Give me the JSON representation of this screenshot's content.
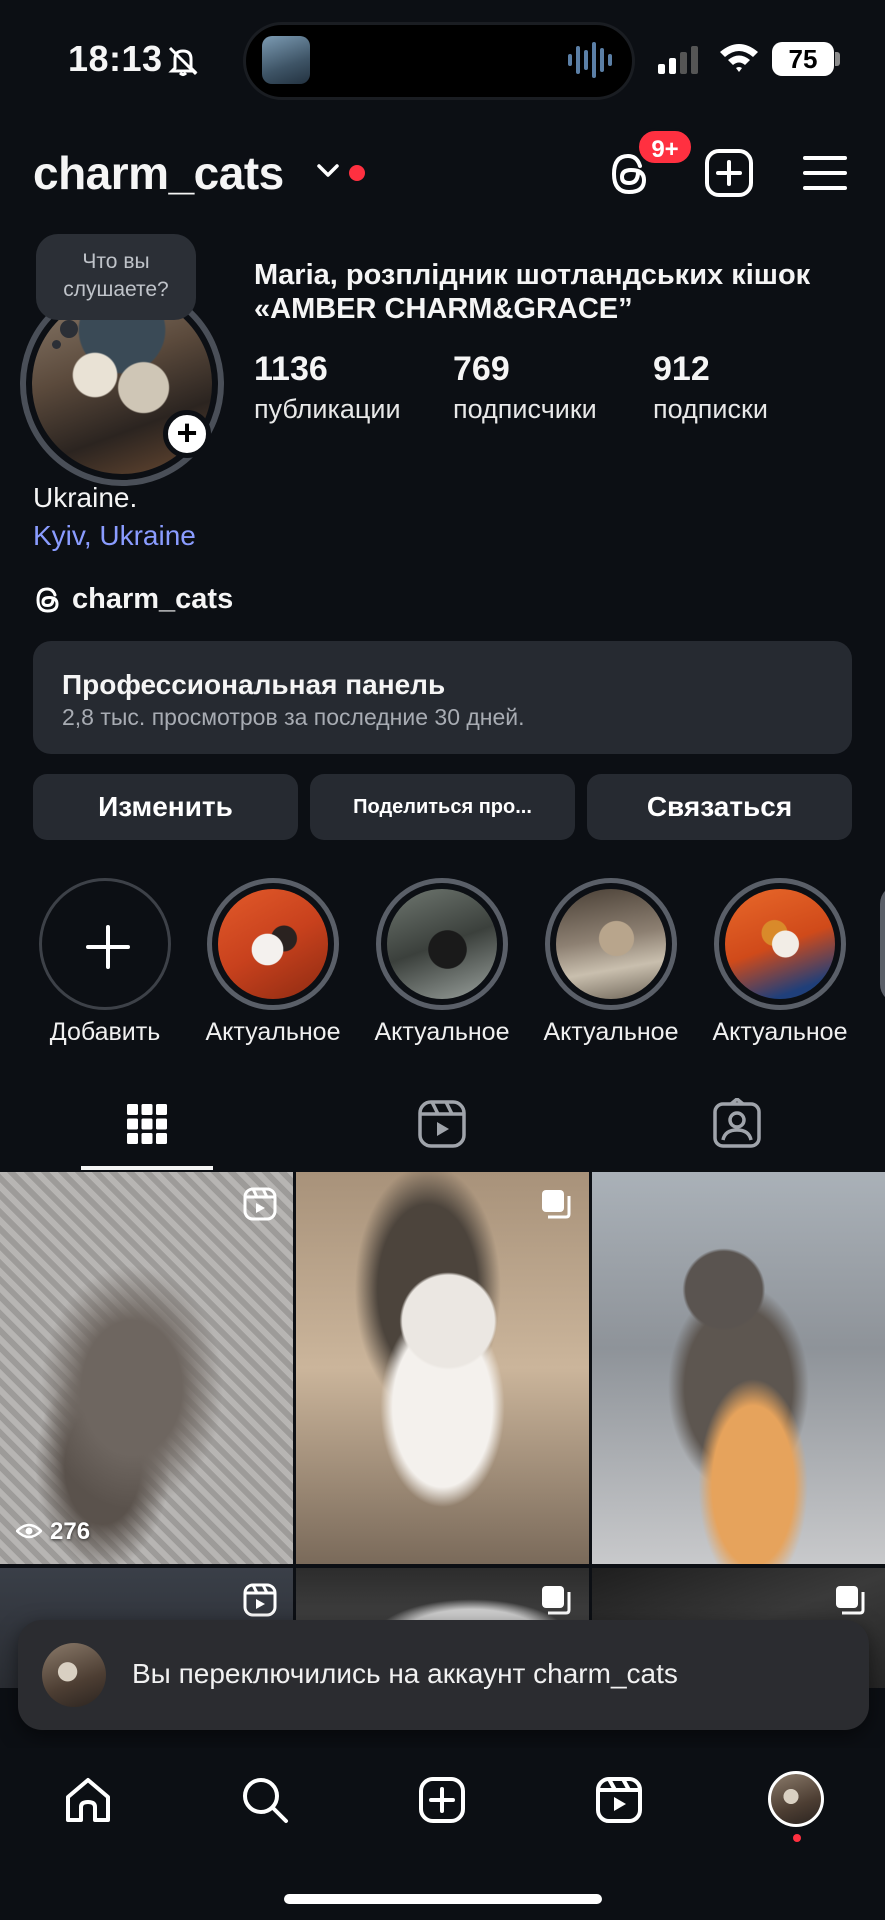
{
  "status_bar": {
    "time": "18:13",
    "battery": "75"
  },
  "header": {
    "username": "charm_cats",
    "notification_badge": "9+"
  },
  "profile": {
    "note_placeholder": "Что вы слушаете?",
    "full_name": "Maria, розплідник шотландських кішок «AMBER CHARM&GRACE”",
    "stats": [
      {
        "value": "1136",
        "label": "публикации"
      },
      {
        "value": "769",
        "label": "подписчики"
      },
      {
        "value": "912",
        "label": "подписки"
      }
    ],
    "bio": "Ukraine.",
    "location": "Kyiv, Ukraine",
    "threads_handle": "charm_cats"
  },
  "pro_panel": {
    "title": "Профессиональная панель",
    "subtitle": "2,8 тыс. просмотров за последние 30 дней."
  },
  "buttons": {
    "edit": "Изменить",
    "share": "Поделиться про...",
    "contact": "Связаться"
  },
  "highlights": {
    "add_label": "Добавить",
    "items": [
      {
        "label": "Актуальное"
      },
      {
        "label": "Актуальное"
      },
      {
        "label": "Актуальное"
      },
      {
        "label": "Актуальное"
      }
    ]
  },
  "grid": {
    "first_views": "276"
  },
  "toast": {
    "text": "Вы переключились на аккаунт charm_cats"
  },
  "colors": {
    "background": "#0c0f14",
    "surface": "#262a31",
    "accent_red": "#ff3040",
    "link": "#8a9cff"
  }
}
